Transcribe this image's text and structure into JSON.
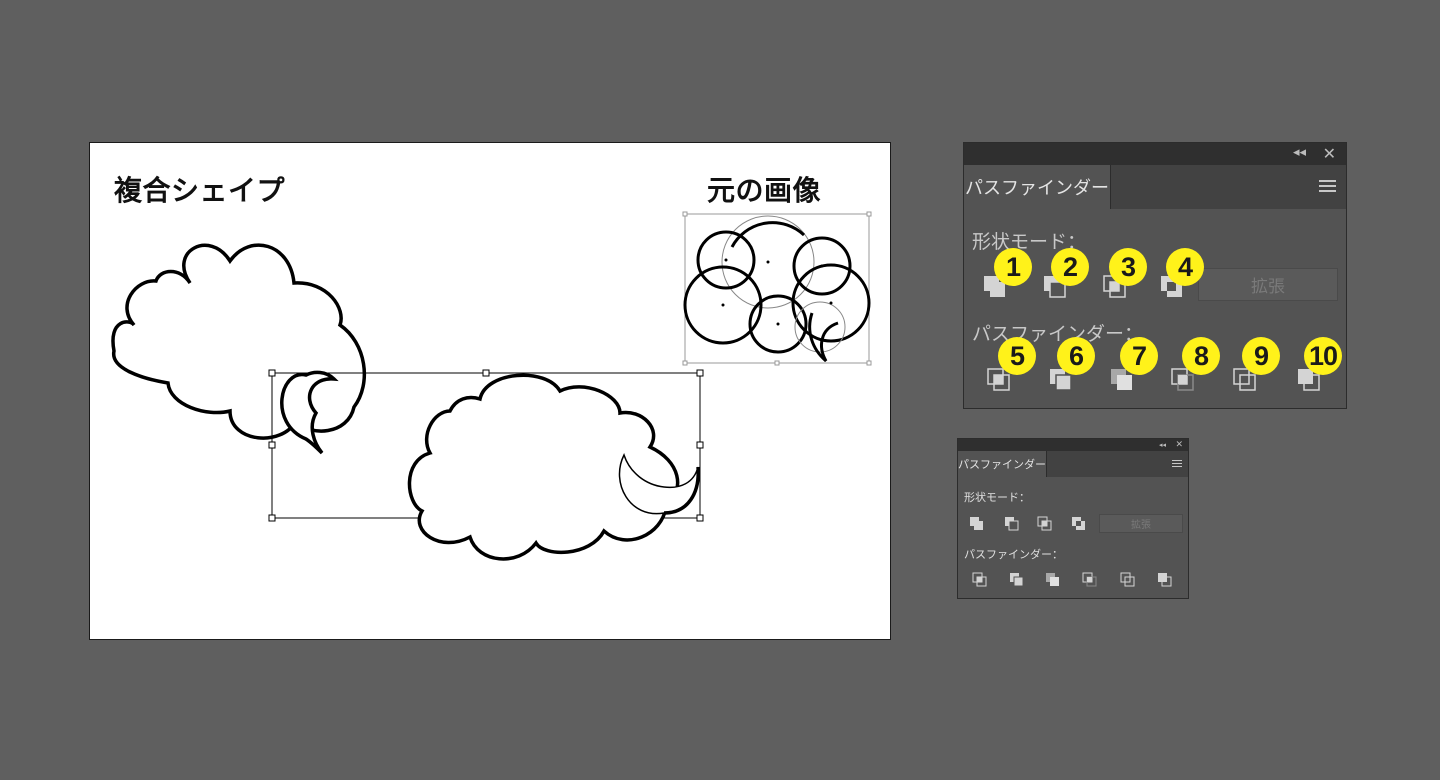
{
  "artboard": {
    "label_compound": "複合シェイプ",
    "label_original": "元の画像"
  },
  "pathfinder_panel_large": {
    "tab_label": "パスファインダー",
    "shape_modes_label": "形状モード：",
    "pathfinders_label": "パスファインダー：",
    "expand_label": "拡張",
    "badges": [
      "1",
      "2",
      "3",
      "4",
      "5",
      "6",
      "7",
      "8",
      "9",
      "10"
    ]
  },
  "pathfinder_panel_small": {
    "tab_label": "パスファインダー",
    "shape_modes_label": "形状モード：",
    "pathfinders_label": "パスファインダー：",
    "expand_label": "拡張"
  },
  "colors": {
    "workspace": "#5f5f5f",
    "panel": "#535353",
    "badge": "#fff21a"
  },
  "icons": {
    "collapse": "double-chevron-left-icon",
    "close": "close-icon",
    "menu": "menu-icon"
  }
}
